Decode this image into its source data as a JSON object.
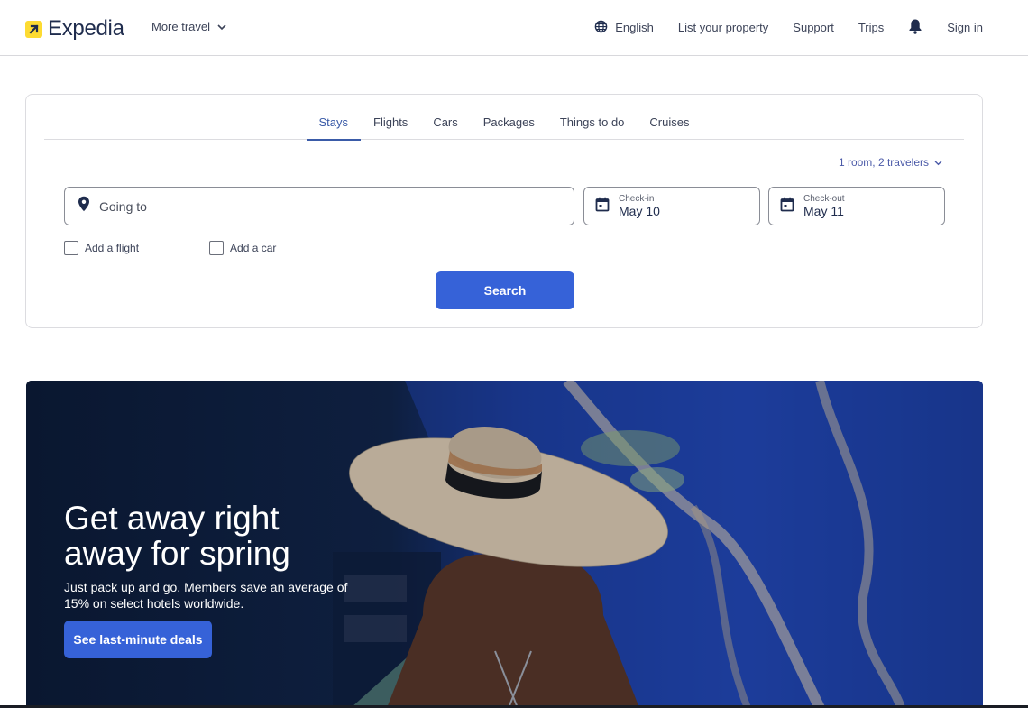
{
  "header": {
    "brand": "Expedia",
    "more_travel": "More travel",
    "language": "English",
    "list_property": "List your property",
    "support": "Support",
    "trips": "Trips",
    "sign_in": "Sign in"
  },
  "search": {
    "tabs": [
      {
        "label": "Stays",
        "active": true
      },
      {
        "label": "Flights",
        "active": false
      },
      {
        "label": "Cars",
        "active": false
      },
      {
        "label": "Packages",
        "active": false
      },
      {
        "label": "Things to do",
        "active": false
      },
      {
        "label": "Cruises",
        "active": false
      }
    ],
    "travelers": "1 room, 2 travelers",
    "going_to_placeholder": "Going to",
    "checkin": {
      "label": "Check-in",
      "value": "May 10"
    },
    "checkout": {
      "label": "Check-out",
      "value": "May 11"
    },
    "add_flight": "Add a flight",
    "add_car": "Add a car",
    "search_button": "Search"
  },
  "hero": {
    "title_line1": "Get away right",
    "title_line2": "away for spring",
    "subtitle": "Just pack up and go. Members save an average of 15% on select hotels worldwide.",
    "cta": "See last-minute deals"
  },
  "colors": {
    "brand_yellow": "#fddb32",
    "primary_blue": "#3662d8",
    "active_tab": "#3a5ba8",
    "text_dark": "#1f2c4d"
  }
}
